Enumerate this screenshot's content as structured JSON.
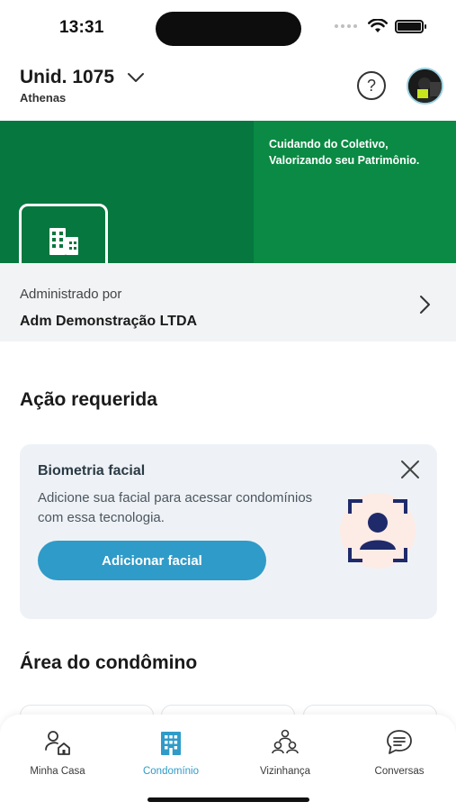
{
  "status_bar": {
    "time": "13:31",
    "icons": [
      "signal-dots-icon",
      "wifi-icon",
      "battery-icon"
    ]
  },
  "header": {
    "unit_title": "Unid. 1075",
    "unit_subtitle": "Athenas",
    "help_icon": "question-circle-icon",
    "avatar": "user-avatar"
  },
  "banner": {
    "slogan_line1": "Cuidando do Coletivo,",
    "slogan_line2": "Valorizando seu Patrimônio.",
    "logo_icon": "building-icon",
    "colors": {
      "dark_green": "#05773f",
      "light_green": "#0a8a44"
    }
  },
  "admin": {
    "label": "Administrado por",
    "name": "Adm Demonstração LTDA"
  },
  "action_required": {
    "title": "Ação requerida",
    "card": {
      "title": "Biometria facial",
      "description": "Adicione sua facial para acessar condomínios com essa tecnologia.",
      "button_label": "Adicionar facial",
      "close_icon": "close-icon",
      "illustration": "face-scan-icon"
    }
  },
  "condo_area": {
    "title": "Área do condômino"
  },
  "tabbar": {
    "tabs": [
      {
        "label": "Minha Casa",
        "icon": "user-home-icon",
        "active": false
      },
      {
        "label": "Condomínio",
        "icon": "building-icon",
        "active": true
      },
      {
        "label": "Vizinhança",
        "icon": "neighbors-icon",
        "active": false
      },
      {
        "label": "Conversas",
        "icon": "chat-icon",
        "active": false
      }
    ],
    "active_color": "#2f9bc8"
  }
}
